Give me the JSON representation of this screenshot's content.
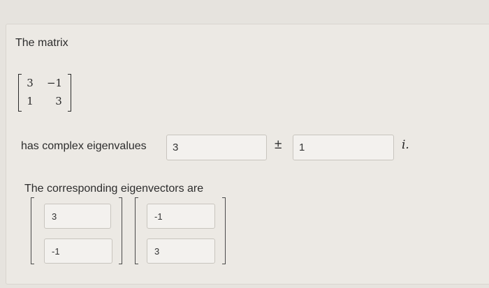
{
  "question": {
    "title": "The matrix",
    "matrix": [
      [
        "3",
        "−1"
      ],
      [
        "1",
        "3"
      ]
    ],
    "eigenvalues_label": "has complex eigenvalues",
    "real_part": "3",
    "plus_minus": "±",
    "imag_part": "1",
    "imag_unit": "i.",
    "eigenvectors_label": "The corresponding eigenvectors are",
    "eigenvector_1": [
      "3",
      "-1"
    ],
    "eigenvector_2": [
      "-1",
      "3"
    ]
  }
}
